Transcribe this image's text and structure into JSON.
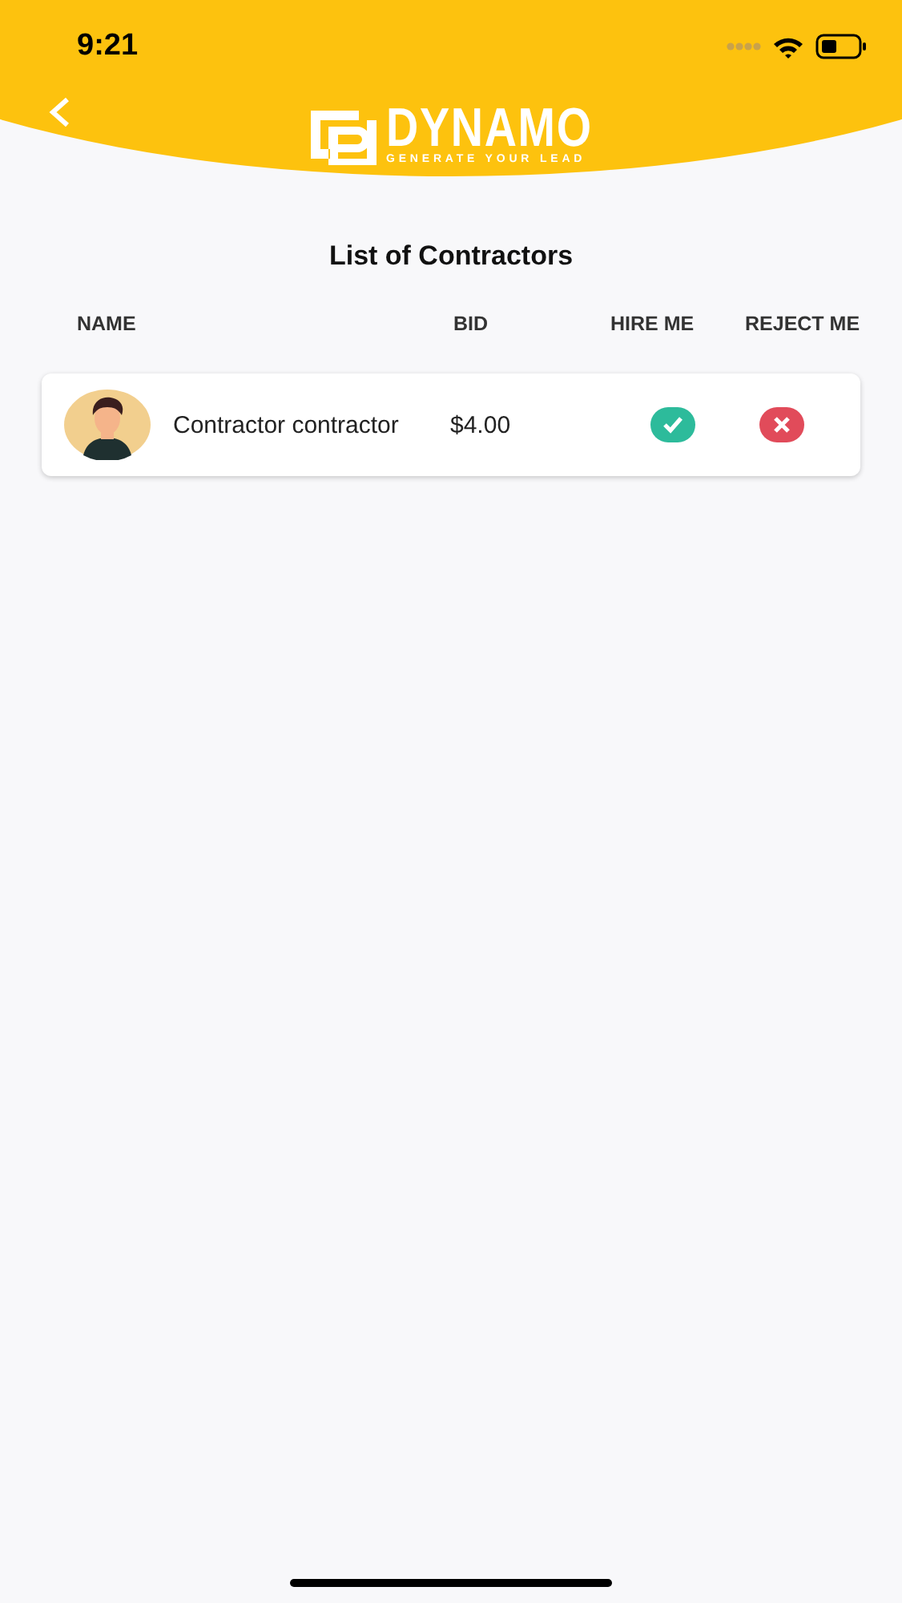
{
  "status_bar": {
    "time": "9:21"
  },
  "header": {
    "logo_title": "DYNAMO",
    "logo_tagline": "GENERATE YOUR LEAD"
  },
  "title": "List of Contractors",
  "table": {
    "columns": [
      "NAME",
      "BID",
      "HIRE ME",
      "REJECT ME"
    ],
    "rows": [
      {
        "name": "Contractor contractor",
        "bid": "$4.00"
      }
    ]
  }
}
